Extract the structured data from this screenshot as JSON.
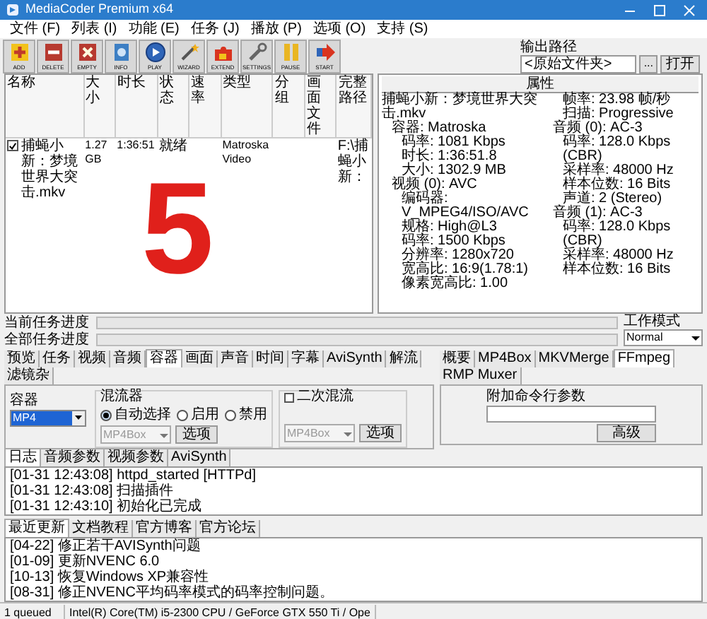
{
  "window": {
    "title": "MediaCoder Premium x64"
  },
  "menu": [
    "文件 (F)",
    "列表 (I)",
    "功能 (E)",
    "任务 (J)",
    "播放 (P)",
    "选项 (O)",
    "支持 (S)"
  ],
  "toolbar": [
    {
      "label": "ADD",
      "kind": "add"
    },
    {
      "label": "DELETE",
      "kind": "delete"
    },
    {
      "label": "EMPTY",
      "kind": "empty"
    },
    {
      "label": "INFO",
      "kind": "info"
    },
    {
      "label": "PLAY",
      "kind": "play"
    },
    {
      "label": "WIZARD",
      "kind": "wizard"
    },
    {
      "label": "EXTEND",
      "kind": "extend"
    },
    {
      "label": "SETTINGS",
      "kind": "settings"
    },
    {
      "label": "PAUSE",
      "kind": "pause"
    },
    {
      "label": "START",
      "kind": "start"
    }
  ],
  "output_path": {
    "label": "输出路径",
    "value": "<原始文件夹>",
    "browse": "...",
    "open": "打开"
  },
  "file_list": {
    "columns": [
      "名称",
      "大小",
      "时长",
      "状态",
      "速率",
      "类型",
      "分组",
      "画面文件",
      "完整路径"
    ],
    "rows": [
      {
        "checked": true,
        "cells": [
          "捕蝇小新：梦境世界大突击.mkv",
          "1.27 GB",
          "1:36:51",
          "就绪",
          "",
          "Matroska Video",
          "",
          "",
          "F:\\捕蝇小新："
        ]
      }
    ]
  },
  "properties": {
    "title": "属性",
    "tree": [
      {
        "label": "捕蝇小新：梦境世界大突击.mkv",
        "children": [
          {
            "label": "容器: Matroska",
            "children": [
              {
                "label": "码率: 1081 Kbps"
              },
              {
                "label": "时长: 1:36:51.8"
              },
              {
                "label": "大小: 1302.9 MB"
              }
            ]
          },
          {
            "label": "视频 (0): AVC",
            "children": [
              {
                "label": "编码器: V_MPEG4/ISO/AVC"
              },
              {
                "label": "规格: High@L3"
              },
              {
                "label": "码率: 1500 Kbps"
              },
              {
                "label": "分辨率: 1280x720"
              },
              {
                "label": "宽高比: 16:9(1.78:1)"
              },
              {
                "label": "像素宽高比: 1.00"
              },
              {
                "label": "帧率: 23.98 帧/秒"
              },
              {
                "label": "扫描: Progressive"
              }
            ]
          },
          {
            "label": "音频 (0): AC-3",
            "children": [
              {
                "label": "码率: 128.0 Kbps (CBR)"
              },
              {
                "label": "采样率: 48000 Hz"
              },
              {
                "label": "样本位数: 16 Bits"
              },
              {
                "label": "声道: 2 (Stereo)"
              }
            ]
          },
          {
            "label": "音频 (1): AC-3",
            "children": [
              {
                "label": "码率: 128.0 Kbps (CBR)"
              },
              {
                "label": "采样率: 48000 Hz"
              },
              {
                "label": "样本位数: 16 Bits"
              }
            ]
          }
        ]
      }
    ]
  },
  "annotation": "5",
  "progress": [
    {
      "label": "当前任务进度",
      "level": 0
    },
    {
      "label": "全部任务进度",
      "level": 0
    }
  ],
  "work_mode": {
    "label": "工作模式",
    "value": "Normal"
  },
  "left_tabs": [
    {
      "label": "预览",
      "selected": false
    },
    {
      "label": "任务",
      "selected": false
    },
    {
      "label": "视频",
      "selected": false
    },
    {
      "label": "音频",
      "selected": false
    },
    {
      "label": "容器",
      "selected": true
    },
    {
      "label": "画面",
      "selected": false
    },
    {
      "label": "声音",
      "selected": false
    },
    {
      "label": "时间",
      "selected": false
    },
    {
      "label": "字幕",
      "selected": false
    },
    {
      "label": "AviSynth",
      "selected": false
    },
    {
      "label": "解流",
      "selected": false
    },
    {
      "label": "滤镜杂",
      "selected": false
    }
  ],
  "container": {
    "label": "容器",
    "value": "MP4"
  },
  "muxer": {
    "label": "混流器",
    "options": [
      {
        "label": "自动选择",
        "selected": true
      },
      {
        "label": "启用",
        "selected": false
      },
      {
        "label": "禁用",
        "selected": false
      }
    ],
    "select": "MP4Box",
    "disabled": true,
    "button": "选项"
  },
  "remux": {
    "label": "二次混流",
    "checked": false,
    "select": "MP4Box",
    "disabled": true,
    "button": "选项"
  },
  "right_tabs": [
    {
      "label": "概要",
      "selected": false
    },
    {
      "label": "MP4Box",
      "selected": false
    },
    {
      "label": "MKVMerge",
      "selected": false
    },
    {
      "label": "FFmpeg",
      "selected": true
    },
    {
      "label": "RMP Muxer",
      "selected": false
    }
  ],
  "extra_args": {
    "label": "附加命令行参数",
    "button": "高级"
  },
  "log": {
    "tabs": [
      {
        "label": "日志",
        "selected": true
      },
      {
        "label": "音频参数",
        "selected": false
      },
      {
        "label": "视频参数",
        "selected": false
      },
      {
        "label": "AviSynth",
        "selected": false
      }
    ],
    "lines": [
      "[01-31 12:43:08] httpd_started [HTTPd]",
      "[01-31 12:43:08] 扫描插件",
      "[01-31 12:43:10] 初始化已完成"
    ]
  },
  "news": {
    "tabs": [
      {
        "label": "最近更新",
        "selected": true
      },
      {
        "label": "文档教程",
        "selected": false
      },
      {
        "label": "官方博客",
        "selected": false
      },
      {
        "label": "官方论坛",
        "selected": false
      }
    ],
    "lines": [
      "[04-22] 修正若干AVISynth问题",
      "[01-09] 更新NVENC 6.0",
      "[10-13] 恢复Windows XP兼容性",
      "[08-31] 修正NVENC平均码率模式的码率控制问题。"
    ]
  },
  "status_bar": [
    "1 queued",
    "Intel(R) Core(TM) i5-2300 CPU  / GeForce GTX 550 Ti / Ope"
  ]
}
